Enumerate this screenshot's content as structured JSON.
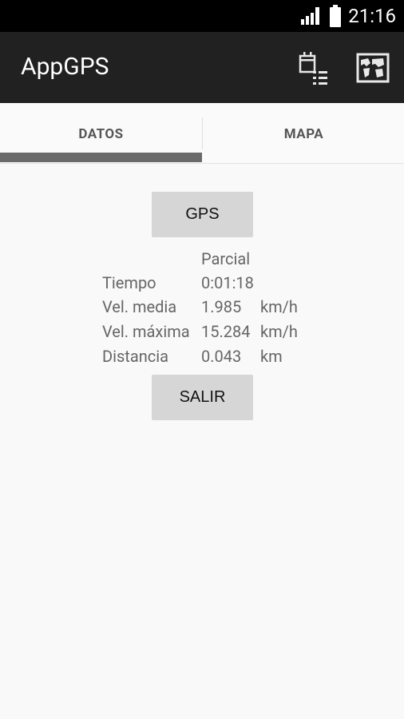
{
  "status_bar": {
    "time": "21:16"
  },
  "app_bar": {
    "title": "AppGPS",
    "actions": [
      {
        "icon": "calendar-list-icon"
      },
      {
        "icon": "map-icon"
      }
    ]
  },
  "tabs": [
    {
      "label": "DATOS",
      "selected": true
    },
    {
      "label": "MAPA",
      "selected": false
    }
  ],
  "main": {
    "gps_button": "GPS",
    "header_value": "Parcial",
    "rows": [
      {
        "label": "Tiempo",
        "value": "0:01:18",
        "unit": ""
      },
      {
        "label": "Vel. media",
        "value": "1.985",
        "unit": "km/h"
      },
      {
        "label": "Vel. máxima",
        "value": "15.284",
        "unit": "km/h"
      },
      {
        "label": "Distancia",
        "value": "0.043",
        "unit": "km"
      }
    ],
    "exit_button": "SALIR"
  },
  "colors": {
    "status_bar": "#000000",
    "app_bar": "#212121",
    "background": "#f9f9f9",
    "tab_indicator": "#6a6a6a",
    "button": "#d6d6d6"
  }
}
